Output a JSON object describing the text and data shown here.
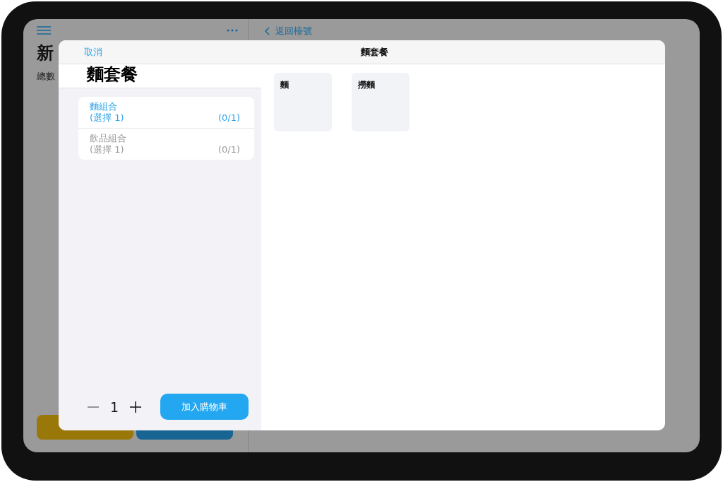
{
  "background": {
    "back_label": "返回檯號",
    "title": "新",
    "subtitle": "總數"
  },
  "modal": {
    "cancel": "取消",
    "title": "麵套餐",
    "heading": "麵套餐",
    "groups": [
      {
        "name": "麵組合",
        "rule": "(選擇 1)",
        "count": "(0/1)",
        "selected": true
      },
      {
        "name": "飲品組合",
        "rule": "(選擇 1)",
        "count": "(0/1)",
        "selected": false
      }
    ],
    "quantity": "1",
    "add_button": "加入購物車",
    "options": [
      {
        "name": "麵"
      },
      {
        "name": "撈麵"
      }
    ]
  }
}
